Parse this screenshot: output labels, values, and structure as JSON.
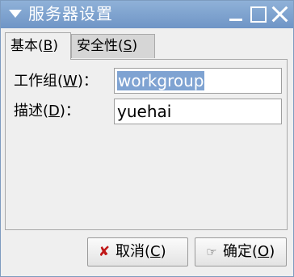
{
  "window": {
    "title": "服务器设置"
  },
  "tabs": [
    {
      "pre": "基本(",
      "key": "B",
      "post": ")"
    },
    {
      "pre": "安全性(",
      "key": "S",
      "post": ")"
    }
  ],
  "form": {
    "workgroup": {
      "label_pre": "工作组(",
      "label_key": "W",
      "label_post": ")：",
      "value": "workgroup"
    },
    "description": {
      "label_pre": "描述(",
      "label_key": "D",
      "label_post": ")：",
      "value": "yuehai"
    }
  },
  "buttons": {
    "cancel": {
      "icon": "cancel-x-icon",
      "pre": "取消(",
      "key": "C",
      "post": ")"
    },
    "ok": {
      "icon": "ok-hand-icon",
      "pre": "确定(",
      "key": "O",
      "post": ")"
    }
  },
  "colors": {
    "titlebar": "#7fa3d2",
    "selection": "#7fa3d2",
    "cancel_icon": "#c01818"
  }
}
